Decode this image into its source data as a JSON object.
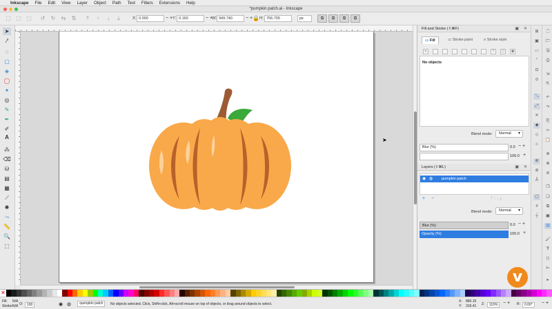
{
  "menubar": {
    "apple": "",
    "app_name": "Inkscape",
    "items": [
      "File",
      "Edit",
      "View",
      "Layer",
      "Object",
      "Path",
      "Text",
      "Filters",
      "Extensions",
      "Help"
    ]
  },
  "window": {
    "title": "*pumpkin patch.ai - Inkscape"
  },
  "toolbar": {
    "x_label": "X:",
    "x_value": "0.000",
    "y_label": "Y:",
    "y_value": "0.160",
    "w_label": "W:",
    "w_value": "949.740",
    "h_label": "H:",
    "h_value": "756.705",
    "unit": "px"
  },
  "canvas": {
    "artwork": "pumpkin",
    "colors": {
      "body": "#f9a94a",
      "ribs": "#b8622a",
      "stem": "#9c5b34",
      "leaf": "#3aa83a",
      "highlight": "#fcd29a"
    }
  },
  "fill_stroke": {
    "title": "Fill and Stroke (⇧⌘F)",
    "tabs": [
      "Fill",
      "Stroke paint",
      "Stroke style"
    ],
    "active_tab": "Fill",
    "status": "No objects",
    "blend_label": "Blend mode:",
    "blend_value": "Normal",
    "blur_label": "Blur (%)",
    "blur_value": "0.0",
    "opacity_value": "100.0"
  },
  "layers": {
    "title": "Layers (⇧⌘L)",
    "items": [
      {
        "name": "pumpkin patch"
      }
    ],
    "blend_label": "Blend mode:",
    "blend_value": "Normal",
    "blur_label": "Blur (%)",
    "blur_value": "0.0",
    "opacity_label": "Opacity (%)",
    "opacity_value": "100.0"
  },
  "palette": {
    "colors": [
      "#000000",
      "#1a1a1a",
      "#333333",
      "#4d4d4d",
      "#666666",
      "#808080",
      "#999999",
      "#b3b3b3",
      "#cccccc",
      "#e6e6e6",
      "#ffffff",
      "#800000",
      "#ff0000",
      "#ff6600",
      "#ffcc00",
      "#ffff00",
      "#99cc00",
      "#00ff00",
      "#00ffcc",
      "#00ccff",
      "#0066ff",
      "#0000ff",
      "#6600ff",
      "#cc00ff",
      "#ff00cc",
      "#ff0066",
      "#4d0000",
      "#800000",
      "#aa0000",
      "#d40000",
      "#ff2a2a",
      "#ff5555",
      "#ff8080",
      "#ffaaaa",
      "#2b0000",
      "#552200",
      "#803300",
      "#aa4400",
      "#d45500",
      "#ff6600",
      "#ff7f2a",
      "#ff9955",
      "#ffb380",
      "#ffccaa",
      "#554400",
      "#806600",
      "#aa8800",
      "#d4aa00",
      "#ffcc00",
      "#ffd42a",
      "#ffdd55",
      "#ffe680",
      "#ffeeaa",
      "#224400",
      "#336600",
      "#448800",
      "#55aa00",
      "#66cc00",
      "#88aa00",
      "#aad400",
      "#ccff00",
      "#d4ff2a",
      "#003300",
      "#005500",
      "#008000",
      "#00aa00",
      "#00d400",
      "#00ff00",
      "#2aff2a",
      "#55ff55",
      "#80ff80",
      "#aaffaa",
      "#003333",
      "#005555",
      "#008080",
      "#00aaaa",
      "#00d4d4",
      "#00ffff",
      "#2affff",
      "#55ffff",
      "#80ffff",
      "#002255",
      "#003380",
      "#0044aa",
      "#0055d4",
      "#0066ff",
      "#2a7fff",
      "#5599ff",
      "#80b3ff",
      "#aaccff",
      "#220055",
      "#330080",
      "#4400aa",
      "#5500d4",
      "#6600ff",
      "#7f2aff",
      "#9955ff",
      "#b380ff",
      "#ccaaff",
      "#440044",
      "#660066",
      "#880088",
      "#aa00aa",
      "#d400d4",
      "#ff00ff",
      "#ff2aff",
      "#ff55ff"
    ]
  },
  "status": {
    "fill_label": "Fill:",
    "fill_value": "N/A",
    "stroke_label": "Stroke:",
    "stroke_value": "N/A",
    "opacity_label": "O:",
    "opacity_value": "100",
    "layer": "•pumpkin patch",
    "message": "No objects selected. Click, Shift+click, Alt+scroll mouse on top of objects, or drag around objects to select.",
    "x_label": "X:",
    "x_value": "860.15",
    "y_label": "Y:",
    "y_value": "319.41",
    "zoom_label": "Z:",
    "zoom_value": "115%",
    "rotation_label": "R:",
    "rotation_value": "0.00°"
  },
  "badge": {
    "letter": "v"
  }
}
